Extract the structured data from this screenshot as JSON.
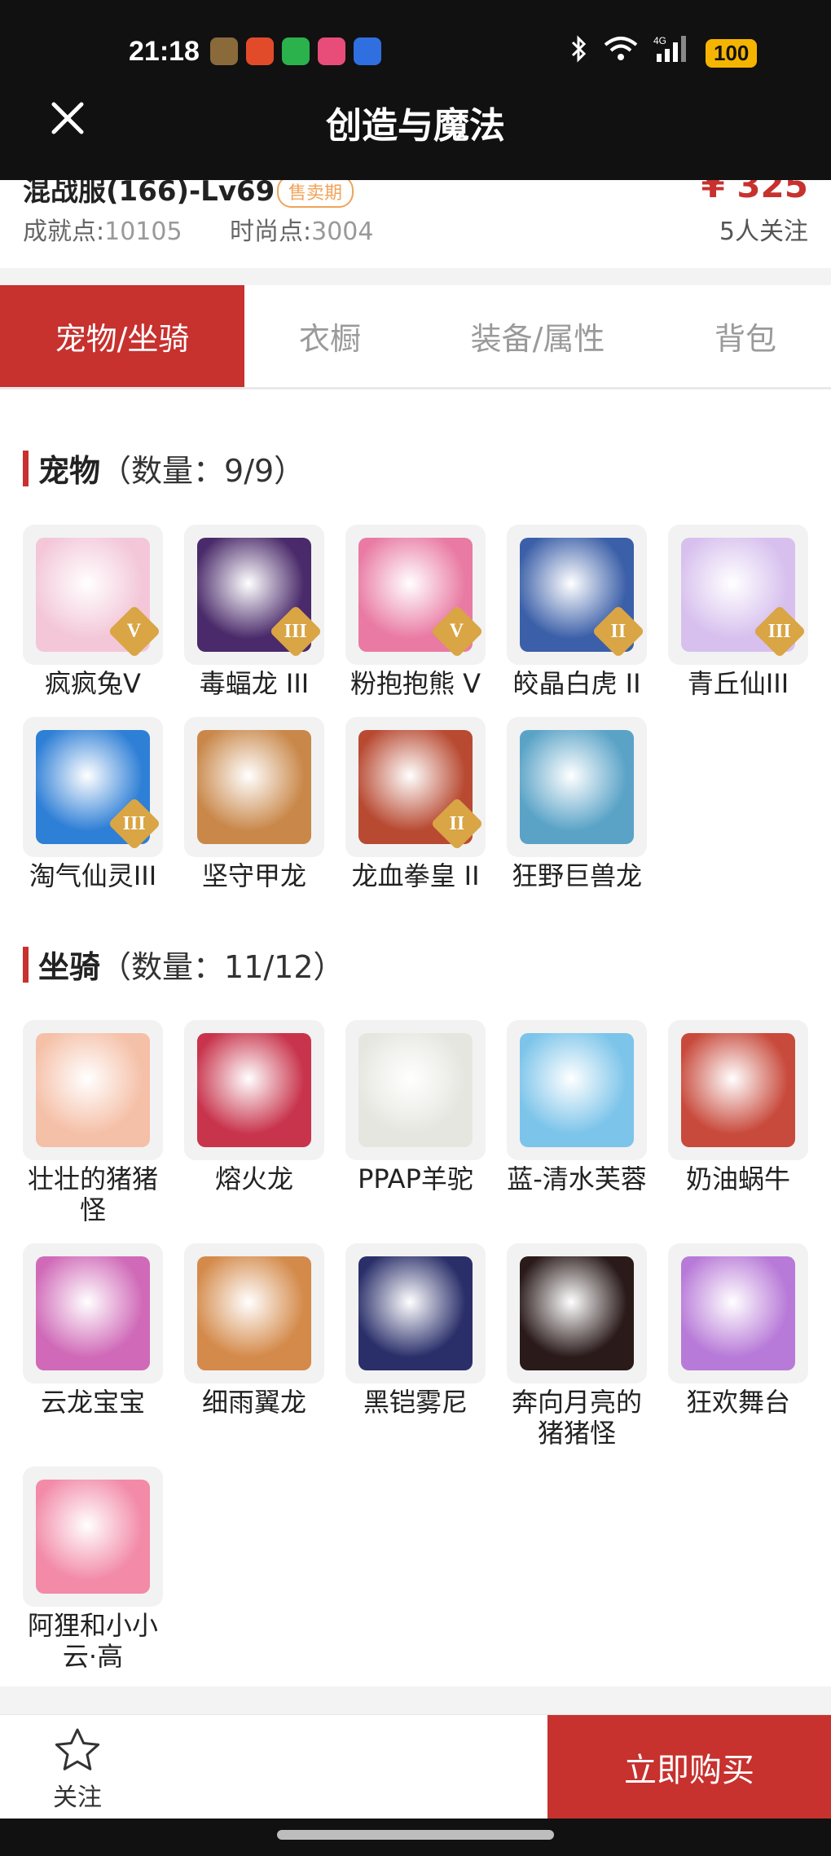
{
  "status": {
    "time": "21:18",
    "network": "4G",
    "battery": "100",
    "app_icon_colors": [
      "#8a6a3a",
      "#e24b2a",
      "#2bb24c",
      "#e84d7a",
      "#2f6fe0"
    ]
  },
  "header": {
    "title": "创造与魔法",
    "close_icon": "close-icon"
  },
  "summary": {
    "server": "混战服(166)-Lv69",
    "badge": "售卖期",
    "price": "¥ 325",
    "achievement_label": "成就点:",
    "achievement_value": "10105",
    "fashion_label": "时尚点:",
    "fashion_value": "3004",
    "watchers": "5人关注"
  },
  "tabs": [
    {
      "label": "宠物/坐骑",
      "active": true
    },
    {
      "label": "衣橱",
      "active": false
    },
    {
      "label": "装备/属性",
      "active": false
    },
    {
      "label": "背包",
      "active": false
    }
  ],
  "pets": {
    "title": "宠物",
    "count": "（数量：9/9）",
    "items": [
      {
        "name": "疯疯兔V",
        "rank": "V",
        "color": "#f3c7d8"
      },
      {
        "name": "毒蝠龙 III",
        "rank": "III",
        "color": "#4a2a6a"
      },
      {
        "name": "粉抱抱熊 V",
        "rank": "V",
        "color": "#e97aa3"
      },
      {
        "name": "皎晶白虎 II",
        "rank": "II",
        "color": "#3b5fa8"
      },
      {
        "name": "青丘仙III",
        "rank": "III",
        "color": "#d7c0ee"
      },
      {
        "name": "淘气仙灵III",
        "rank": "III",
        "color": "#2e7fd6"
      },
      {
        "name": "坚守甲龙",
        "rank": "",
        "color": "#c9884a"
      },
      {
        "name": "龙血拳皇 II",
        "rank": "II",
        "color": "#b84a32"
      },
      {
        "name": "狂野巨兽龙",
        "rank": "",
        "color": "#5aa3c7"
      }
    ]
  },
  "mounts": {
    "title": "坐骑",
    "count": "（数量：11/12）",
    "items": [
      {
        "name": "壮壮的猪猪怪",
        "color": "#f5c0a8"
      },
      {
        "name": "熔火龙",
        "color": "#c8344c"
      },
      {
        "name": "PPAP羊驼",
        "color": "#e6e6e0"
      },
      {
        "name": "蓝-清水芙蓉",
        "color": "#7cc4ea"
      },
      {
        "name": "奶油蜗牛",
        "color": "#c84a3c"
      },
      {
        "name": "云龙宝宝",
        "color": "#d06ab8"
      },
      {
        "name": "细雨翼龙",
        "color": "#d48a4a"
      },
      {
        "name": "黑铠雾尼",
        "color": "#2a2f6a"
      },
      {
        "name": "奔向月亮的猪猪怪",
        "color": "#2a1a1a"
      },
      {
        "name": "狂欢舞台",
        "color": "#b87ad8"
      },
      {
        "name": "阿狸和小小云·高",
        "color": "#f28aa8"
      }
    ]
  },
  "footer": {
    "follow_label": "关注",
    "buy_label": "立即购买"
  },
  "colors": {
    "accent": "#c7312e",
    "badge": "#f0a35a",
    "rank": "#d9a545"
  }
}
